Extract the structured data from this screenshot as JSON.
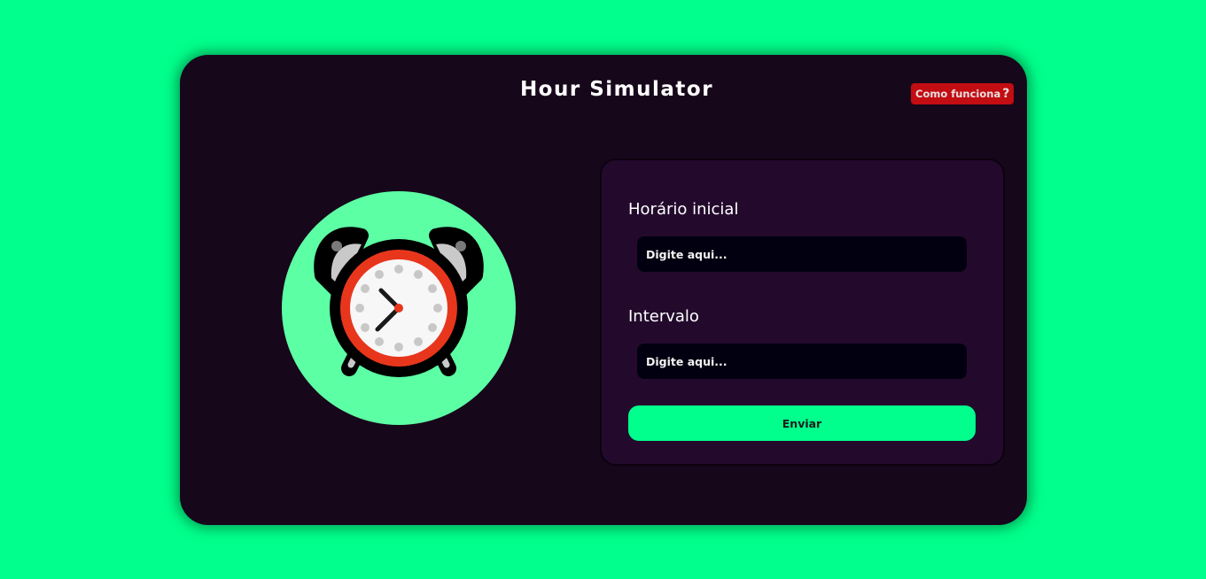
{
  "header": {
    "title": "Hour Simulator",
    "help_label": "Como funciona",
    "help_icon": "question-mark-icon"
  },
  "illustration": {
    "icon": "alarm-clock-icon"
  },
  "form": {
    "start_time": {
      "label": "Horário inicial",
      "placeholder": "Digite aqui...",
      "value": ""
    },
    "interval": {
      "label": "Intervalo",
      "placeholder": "Digite aqui...",
      "value": ""
    },
    "submit_label": "Enviar"
  },
  "colors": {
    "page_background": "#00ff8c",
    "card_background": "#17071b",
    "panel_background": "#230a2d",
    "input_background": "#020010",
    "accent": "#00ff8c",
    "help_button": "#c20d12",
    "clock_circle": "#5dffa5",
    "clock_ring": "#e8361c"
  }
}
